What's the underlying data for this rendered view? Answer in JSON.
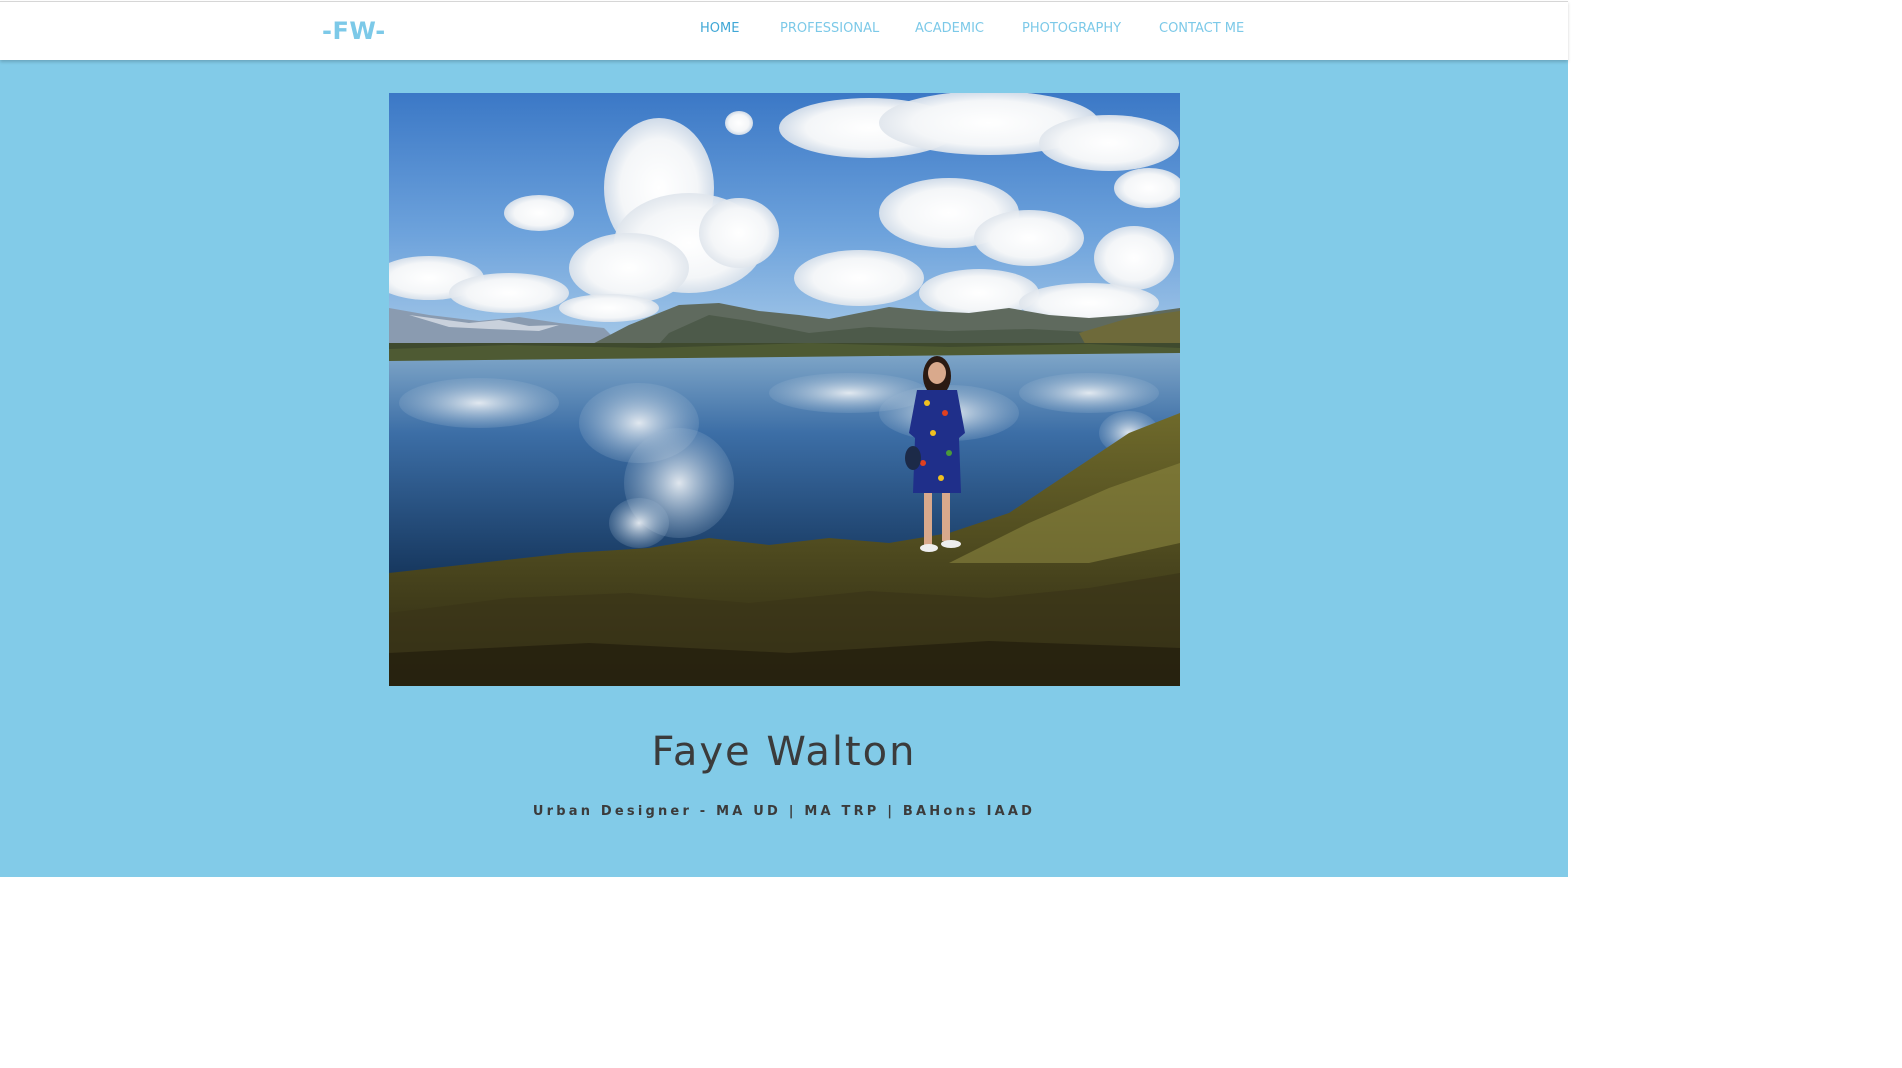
{
  "header": {
    "logo": "-FW-",
    "nav": [
      {
        "label": "HOME",
        "active": true
      },
      {
        "label": "PROFESSIONAL",
        "active": false
      },
      {
        "label": "ACADEMIC",
        "active": false
      },
      {
        "label": "PHOTOGRAPHY",
        "active": false
      },
      {
        "label": "CONTACT ME",
        "active": false
      }
    ]
  },
  "hero": {
    "image": "lake-mountain-portrait-photo"
  },
  "profile": {
    "name": "Faye Walton",
    "title": "Urban Designer - MA UD | MA TRP | BAHons IAAD"
  },
  "colors": {
    "background": "#82cbe8",
    "accent": "#7cc9e8",
    "nav_active": "#3fa7d6",
    "text": "#3b3b3b"
  }
}
